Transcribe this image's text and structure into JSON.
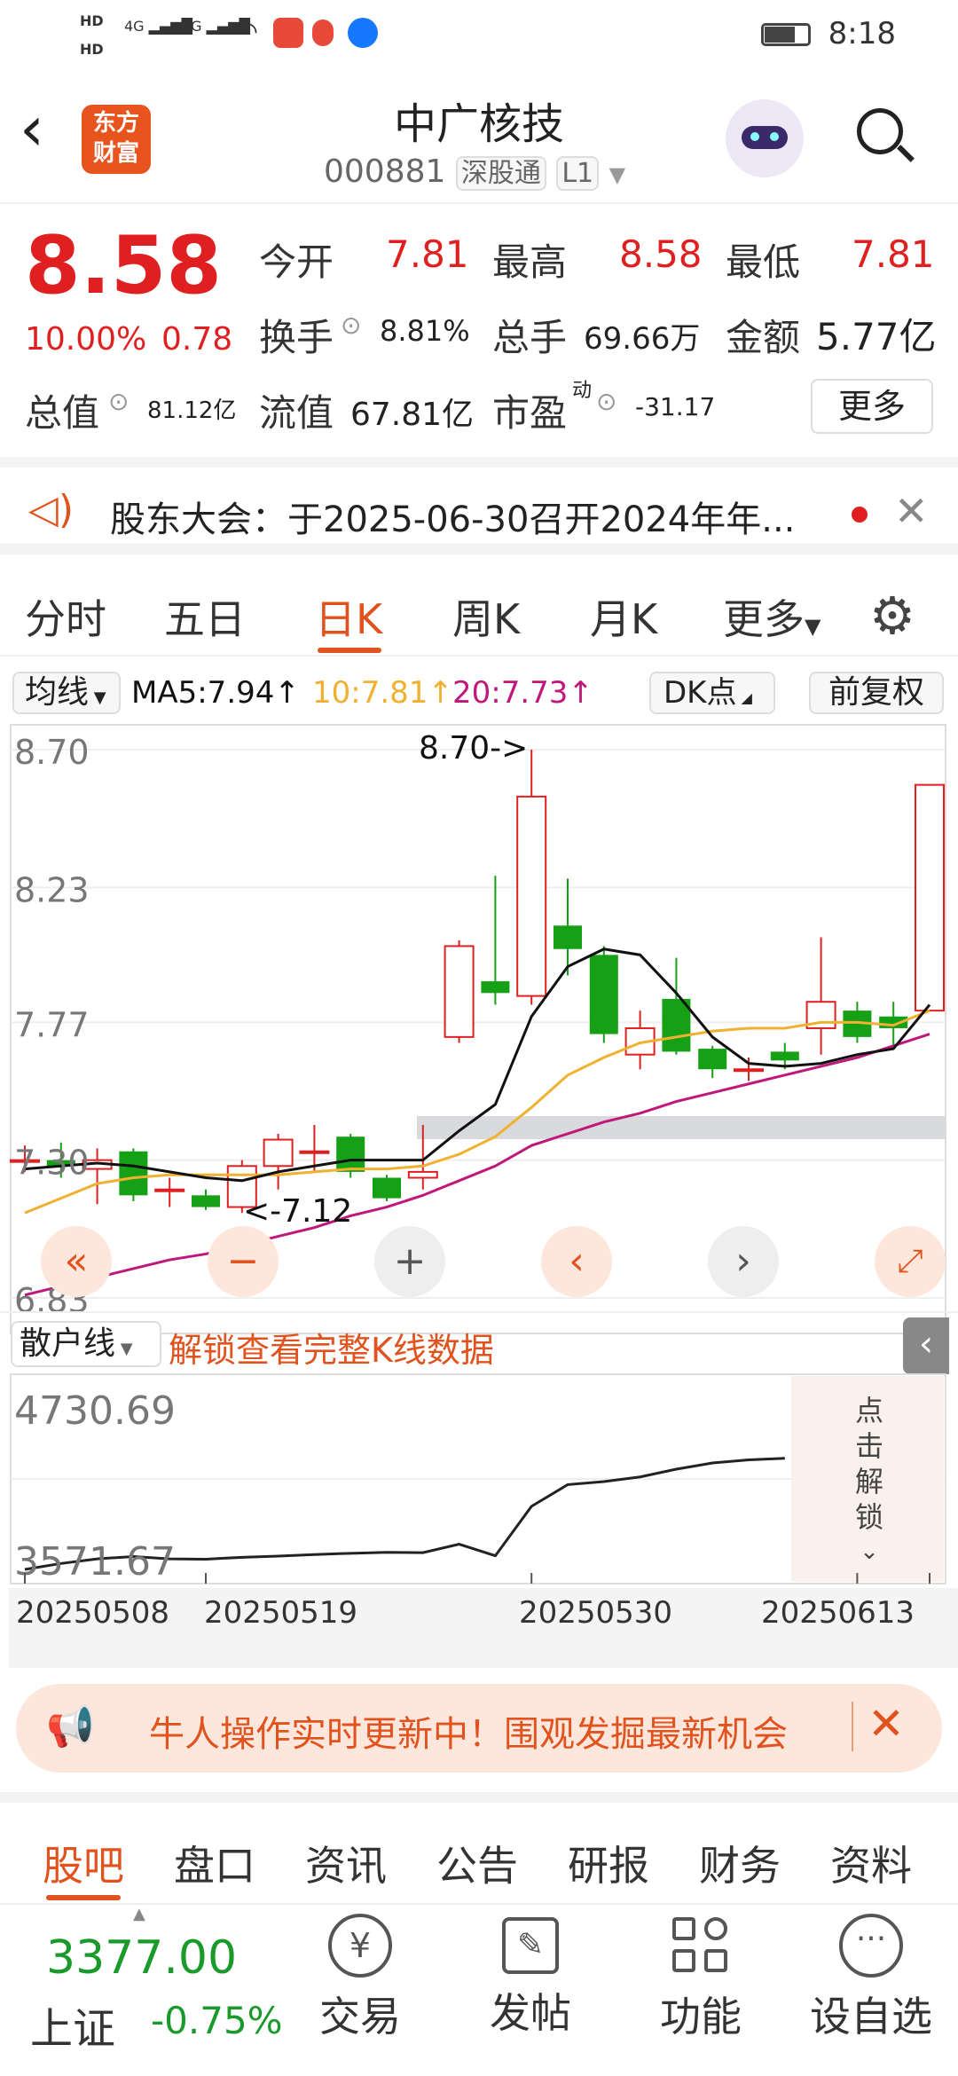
{
  "status": {
    "time": "8:18",
    "hd1": "HD",
    "hd2": "HD",
    "sig1": "4G",
    "sig2": "4G"
  },
  "header": {
    "logo_line1": "东方",
    "logo_line2": "财富",
    "title": "中广核技",
    "code": "000881",
    "badge1": "深股通",
    "badge2": "L1"
  },
  "quote": {
    "price": "8.58",
    "change_pct": "10.00%",
    "change_abs": "0.78",
    "open_label": "今开",
    "open": "7.81",
    "high_label": "最高",
    "high": "8.58",
    "low_label": "最低",
    "low": "7.81",
    "turnover_label": "换手",
    "turnover": "8.81%",
    "volume_label": "总手",
    "volume": "69.66万",
    "amount_label": "金额",
    "amount": "5.77亿",
    "mktcap_label": "总值",
    "mktcap": "81.12亿",
    "float_label": "流值",
    "float": "67.81亿",
    "pe_label": "市盈",
    "pe_sup": "动",
    "pe": "-31.17",
    "more_label": "更多"
  },
  "announce": {
    "text": "股东大会：于2025-06-30召开2024年年..."
  },
  "tabs": [
    "分时",
    "五日",
    "日K",
    "周K",
    "月K",
    "更多"
  ],
  "chart_toolbar": {
    "ma_select": "均线",
    "ma5": "MA5:7.94",
    "ma10": "10:7.81",
    "ma20": "20:7.73",
    "dk": "DK点",
    "adjust": "前复权"
  },
  "chart_data": {
    "type": "candlestick",
    "y_ticks": [
      "8.70",
      "8.23",
      "7.77",
      "7.30",
      "6.83"
    ],
    "ylim": [
      6.83,
      8.7
    ],
    "high_annotation": "8.70->",
    "low_annotation": "<-7.12",
    "x_labels": [
      "20250508",
      "20250519",
      "20250530",
      "20250613"
    ],
    "candles": [
      {
        "o": 7.3,
        "c": 7.3,
        "h": 7.35,
        "l": 7.26
      },
      {
        "o": 7.3,
        "c": 7.28,
        "h": 7.36,
        "l": 7.24
      },
      {
        "o": 7.27,
        "c": 7.3,
        "h": 7.34,
        "l": 7.15
      },
      {
        "o": 7.33,
        "c": 7.18,
        "h": 7.34,
        "l": 7.16
      },
      {
        "o": 7.2,
        "c": 7.2,
        "h": 7.24,
        "l": 7.14
      },
      {
        "o": 7.18,
        "c": 7.14,
        "h": 7.2,
        "l": 7.13
      },
      {
        "o": 7.14,
        "c": 7.28,
        "h": 7.3,
        "l": 7.12
      },
      {
        "o": 7.28,
        "c": 7.37,
        "h": 7.39,
        "l": 7.2
      },
      {
        "o": 7.33,
        "c": 7.33,
        "h": 7.42,
        "l": 7.26
      },
      {
        "o": 7.38,
        "c": 7.26,
        "h": 7.39,
        "l": 7.24
      },
      {
        "o": 7.24,
        "c": 7.17,
        "h": 7.25,
        "l": 7.16
      },
      {
        "o": 7.24,
        "c": 7.26,
        "h": 7.42,
        "l": 7.2
      },
      {
        "o": 7.72,
        "c": 8.03,
        "h": 8.05,
        "l": 7.7
      },
      {
        "o": 7.91,
        "c": 7.87,
        "h": 8.27,
        "l": 7.83
      },
      {
        "o": 7.86,
        "c": 8.54,
        "h": 8.7,
        "l": 7.83
      },
      {
        "o": 8.1,
        "c": 8.02,
        "h": 8.26,
        "l": 7.93
      },
      {
        "o": 8.0,
        "c": 7.73,
        "h": 8.03,
        "l": 7.7
      },
      {
        "o": 7.66,
        "c": 7.75,
        "h": 7.81,
        "l": 7.61
      },
      {
        "o": 7.85,
        "c": 7.67,
        "h": 7.99,
        "l": 7.66
      },
      {
        "o": 7.68,
        "c": 7.61,
        "h": 7.69,
        "l": 7.58
      },
      {
        "o": 7.61,
        "c": 7.61,
        "h": 7.65,
        "l": 7.57
      },
      {
        "o": 7.67,
        "c": 7.64,
        "h": 7.7,
        "l": 7.61
      },
      {
        "o": 7.75,
        "c": 7.84,
        "h": 8.06,
        "l": 7.66
      },
      {
        "o": 7.81,
        "c": 7.72,
        "h": 7.84,
        "l": 7.7
      },
      {
        "o": 7.79,
        "c": 7.75,
        "h": 7.84,
        "l": 7.68
      },
      {
        "o": 7.81,
        "c": 8.58,
        "h": 8.58,
        "l": 7.81
      }
    ],
    "ma5": [
      7.27,
      7.28,
      7.29,
      7.28,
      7.26,
      7.24,
      7.23,
      7.26,
      7.28,
      7.3,
      7.3,
      7.3,
      7.4,
      7.49,
      7.79,
      7.96,
      8.02,
      8.0,
      7.87,
      7.72,
      7.63,
      7.62,
      7.63,
      7.66,
      7.68,
      7.83
    ],
    "ma10": [
      7.12,
      7.17,
      7.22,
      7.24,
      7.25,
      7.25,
      7.25,
      7.25,
      7.26,
      7.27,
      7.27,
      7.28,
      7.32,
      7.38,
      7.48,
      7.59,
      7.65,
      7.7,
      7.72,
      7.74,
      7.75,
      7.75,
      7.77,
      7.77,
      7.76,
      7.81
    ],
    "ma20": [
      6.84,
      6.87,
      6.9,
      6.93,
      6.96,
      6.98,
      7.01,
      7.04,
      7.07,
      7.11,
      7.14,
      7.18,
      7.23,
      7.28,
      7.35,
      7.39,
      7.43,
      7.46,
      7.5,
      7.53,
      7.56,
      7.59,
      7.62,
      7.65,
      7.69,
      7.73
    ]
  },
  "retail": {
    "select": "散户线",
    "unlock": "解锁查看完整K线数据",
    "y_top": "4730.69",
    "y_bottom": "3571.67",
    "unlock_side": [
      "点",
      "击",
      "解",
      "锁"
    ],
    "values": [
      3571.67,
      3610,
      3640,
      3655,
      3640,
      3638,
      3650,
      3658,
      3668,
      3676,
      3682,
      3680,
      3735,
      3660,
      3980,
      4120,
      4140,
      4170,
      4220,
      4260,
      4280,
      4290
    ]
  },
  "banner": {
    "text": "牛人操作实时更新中！围观发掘最新机会"
  },
  "bottom_tabs": [
    "股吧",
    "盘口",
    "资讯",
    "公告",
    "研报",
    "财务",
    "资料"
  ],
  "bottom_nav": {
    "index_value": "3377.00",
    "index_name": "上证",
    "index_change": "-0.75%",
    "items": [
      "交易",
      "发帖",
      "功能",
      "设自选"
    ]
  },
  "colors": {
    "up": "#e02020",
    "down": "#15a015",
    "accent": "#e0531e",
    "ma5": "#111111",
    "ma10": "#f0b030",
    "ma20": "#c0187a"
  }
}
